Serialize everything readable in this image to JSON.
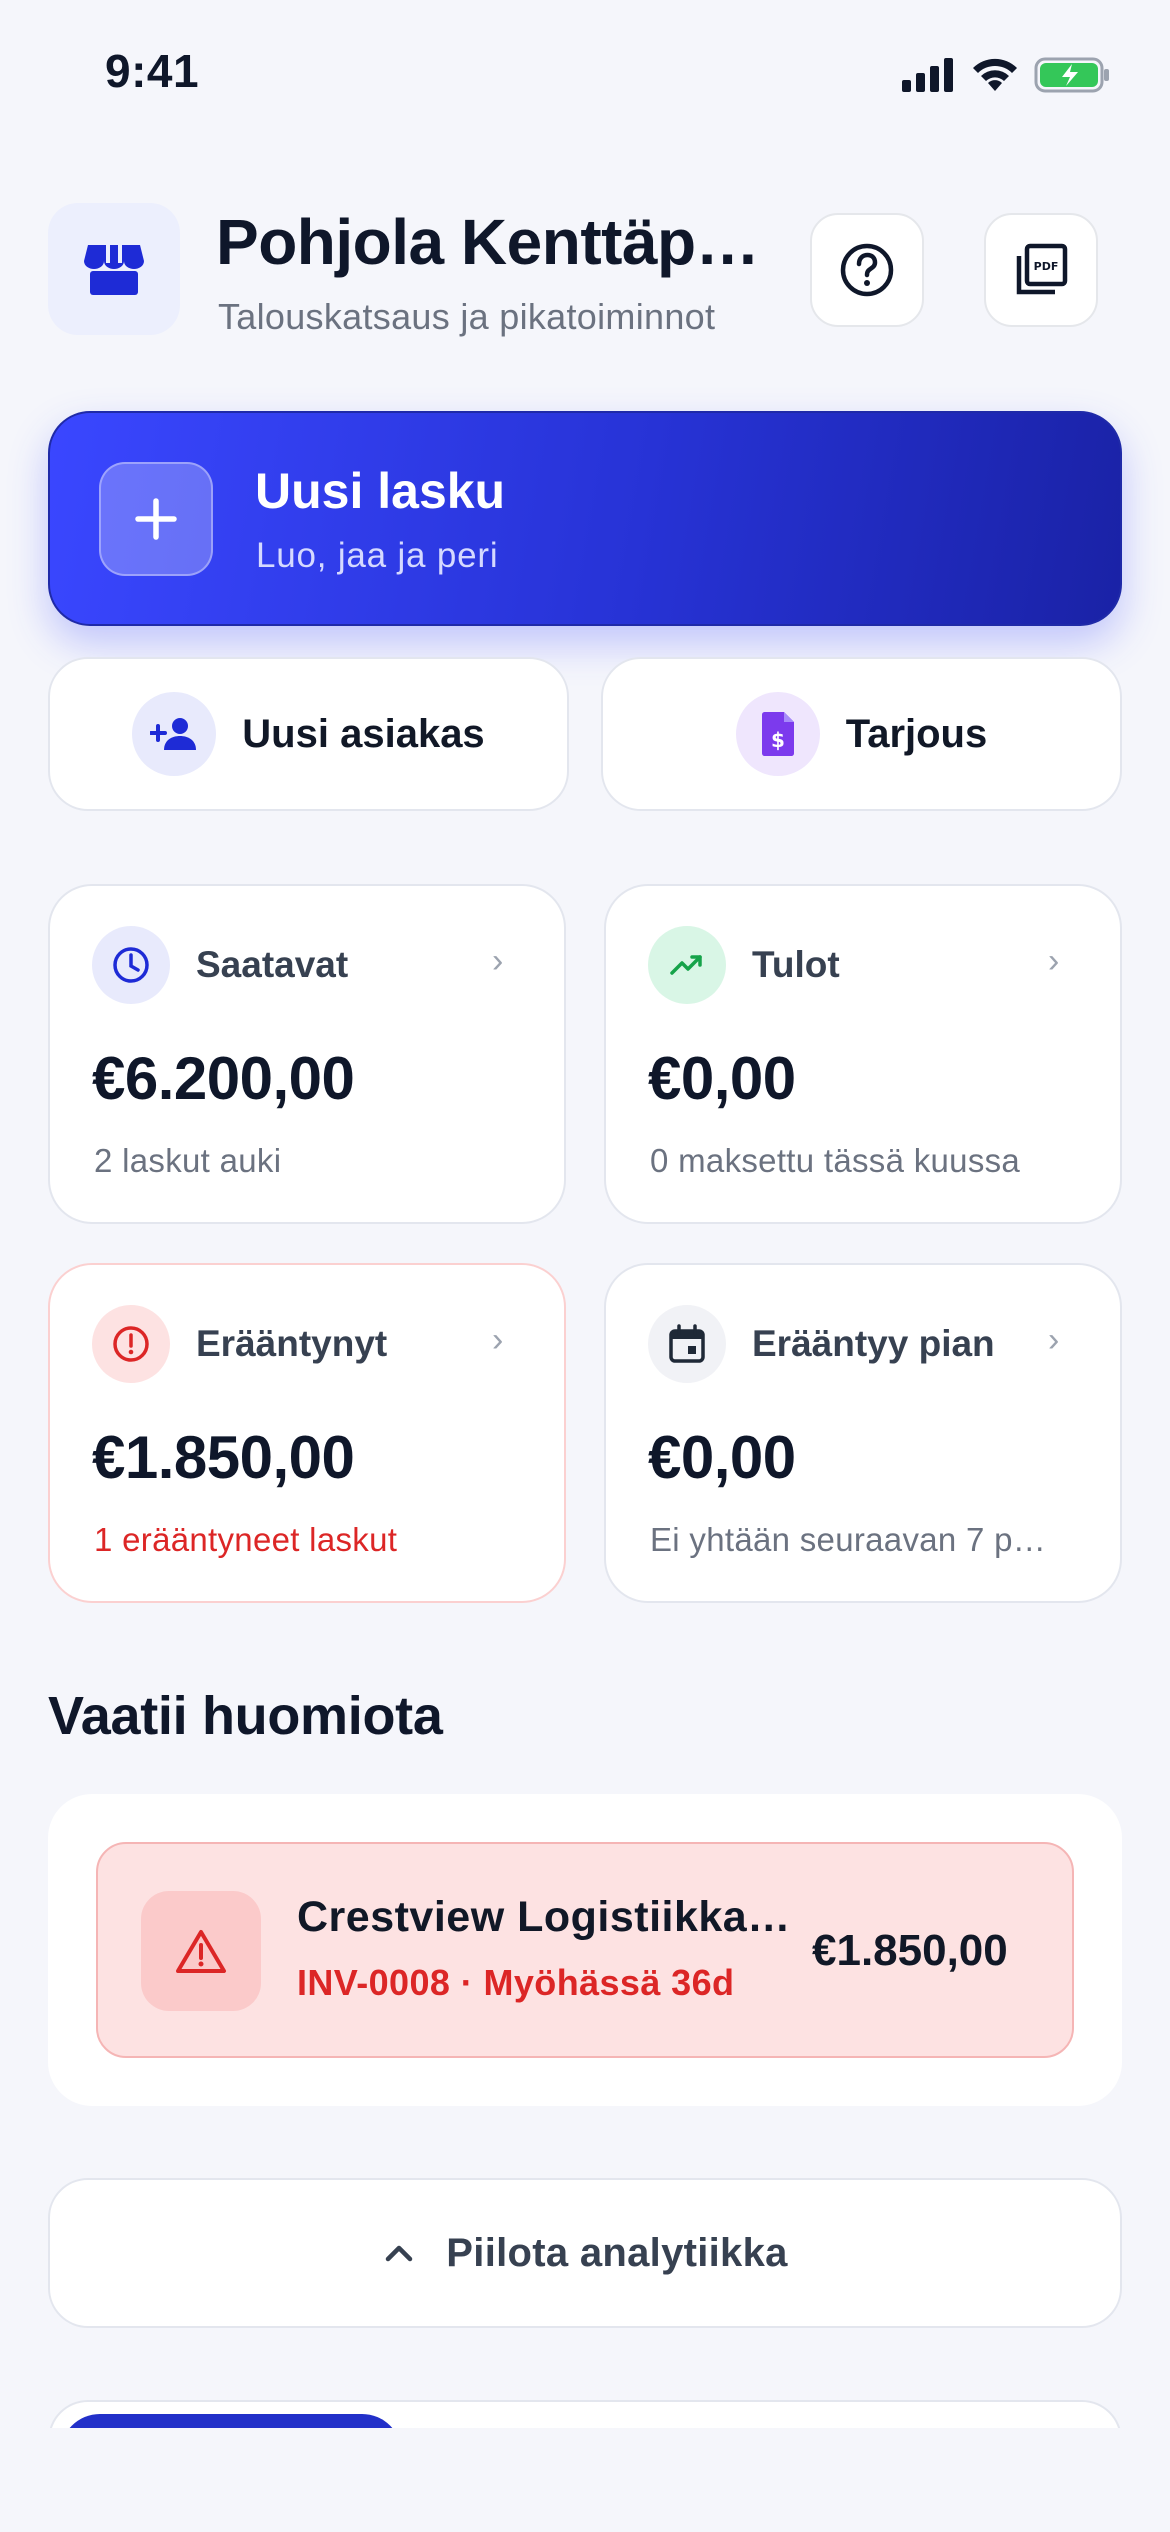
{
  "status_bar": {
    "time": "9:41"
  },
  "header": {
    "title": "Pohjola Kenttäp…",
    "subtitle": "Talouskatsaus ja pikatoiminnot"
  },
  "primary_action": {
    "title": "Uusi lasku",
    "subtitle": "Luo, jaa ja peri"
  },
  "secondary_actions": [
    {
      "label": "Uusi asiakas",
      "icon": "add-user-icon"
    },
    {
      "label": "Tarjous",
      "icon": "quote-document-icon"
    }
  ],
  "stats": [
    {
      "label": "Saatavat",
      "value": "€6.200,00",
      "note": "2 laskut auki",
      "icon": "clock-icon"
    },
    {
      "label": "Tulot",
      "value": "€0,00",
      "note": "0 maksettu tässä kuussa",
      "icon": "trending-up-icon"
    },
    {
      "label": "Erääntynyt",
      "value": "€1.850,00",
      "note": "1 erääntyneet laskut",
      "icon": "alert-circle-icon"
    },
    {
      "label": "Erääntyy pian",
      "value": "€0,00",
      "note": "Ei yhtään seuraavan 7 p…",
      "icon": "calendar-icon"
    }
  ],
  "attention": {
    "heading": "Vaatii huomiota",
    "items": [
      {
        "title": "Crestview Logistiikka…",
        "subtitle": "INV-0008 · Myöhässä 36d",
        "amount": "€1.850,00",
        "icon": "warning-triangle-icon"
      }
    ]
  },
  "analytics_toggle": {
    "label": "Piilota analytiikka"
  },
  "colors": {
    "accent": "#2733d6",
    "danger": "#dc2626",
    "success": "#16a34a",
    "purple": "#7c3aed"
  }
}
